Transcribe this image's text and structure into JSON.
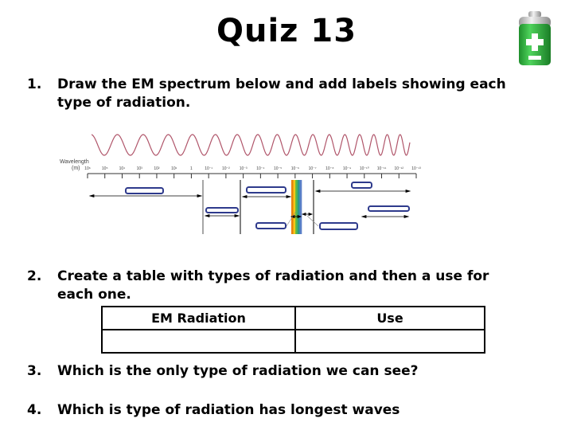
{
  "title": "Quiz 13",
  "battery_icon": {
    "name": "battery-charging-icon",
    "colors": {
      "body": "#2db83d",
      "cap": "#c8c8c8",
      "symbol": "#ffffff"
    }
  },
  "questions": [
    {
      "number": "1.",
      "text": "Draw the EM spectrum below and add labels showing each\ntype of radiation."
    },
    {
      "number": "2.",
      "text": "Create a table with types of radiation and then a use for\neach one."
    },
    {
      "number": "3.",
      "text": "Which is the only type of radiation we can see?"
    },
    {
      "number": "4.",
      "text": "Which is type of radiation has longest waves"
    }
  ],
  "diagram": {
    "axis_label": "Wavelength",
    "axis_unit": "(m)",
    "tick_labels": [
      "10⁶",
      "10⁵",
      "10⁴",
      "10³",
      "10²",
      "10¹",
      "1",
      "10⁻¹",
      "10⁻²",
      "10⁻³",
      "10⁻⁴",
      "10⁻⁵",
      "10⁻⁶",
      "10⁻⁷",
      "10⁻⁸",
      "10⁻⁹",
      "10⁻¹⁰",
      "10⁻¹¹",
      "10⁻¹²",
      "10⁻¹³"
    ],
    "blank_label_count": 7,
    "colors": {
      "wave": "#b0556a",
      "label_box": "#2e3a8c",
      "spectrum": [
        "#e8820c",
        "#f2c818",
        "#58b848",
        "#2a9a8c",
        "#5a7fc8"
      ]
    }
  },
  "table": {
    "headers": [
      "EM Radiation",
      "Use"
    ],
    "rows": [
      [
        "",
        ""
      ]
    ]
  }
}
